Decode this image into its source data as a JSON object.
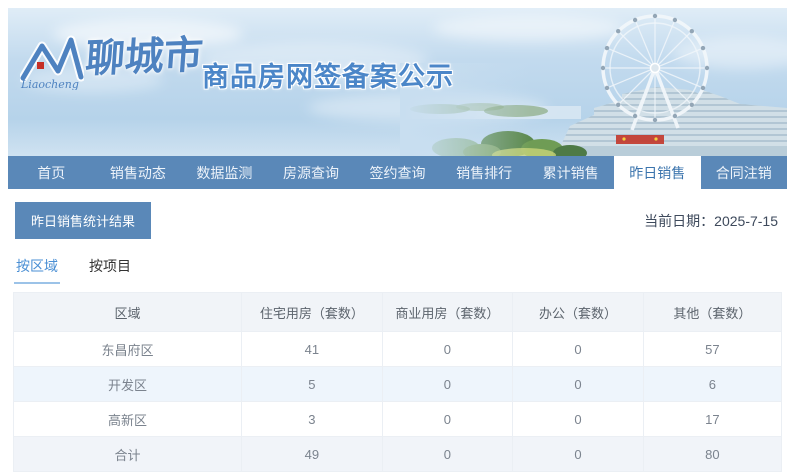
{
  "banner": {
    "logo_script": "Liaocheng",
    "city_name": "聊城市",
    "title": "商品房网签备案公示"
  },
  "nav": {
    "items": [
      {
        "label": "首页"
      },
      {
        "label": "销售动态"
      },
      {
        "label": "数据监测"
      },
      {
        "label": "房源查询"
      },
      {
        "label": "签约查询"
      },
      {
        "label": "销售排行"
      },
      {
        "label": "累计销售"
      },
      {
        "label": "昨日销售",
        "active": true
      },
      {
        "label": "合同注销"
      }
    ]
  },
  "toolbar": {
    "result_button": "昨日销售统计结果",
    "date_label": "当前日期：",
    "date_value": "2025-7-15"
  },
  "tabs": [
    {
      "label": "按区域",
      "active": true
    },
    {
      "label": "按项目",
      "active": false
    }
  ],
  "table": {
    "columns": [
      "区域",
      "住宅用房（套数）",
      "商业用房（套数）",
      "办公（套数）",
      "其他（套数）"
    ],
    "rows": [
      {
        "cells": [
          "东昌府区",
          "41",
          "0",
          "0",
          "57"
        ]
      },
      {
        "cells": [
          "开发区",
          "5",
          "0",
          "0",
          "6"
        ]
      },
      {
        "cells": [
          "高新区",
          "3",
          "0",
          "0",
          "17"
        ]
      },
      {
        "cells": [
          "合计",
          "49",
          "0",
          "0",
          "80"
        ]
      }
    ]
  },
  "colors": {
    "nav_blue": "#5a88b8",
    "banner_title_blue": "#4b86c8",
    "active_nav_text": "#3b74ad",
    "tab_accent": "#4a8fd4",
    "tab_underline": "#9cc3e8",
    "row_stripe_blue": "#eef5fc",
    "total_row_bg": "#f1f4f9",
    "header_bg": "#f1f4f8",
    "logo_red": "#c53027"
  }
}
